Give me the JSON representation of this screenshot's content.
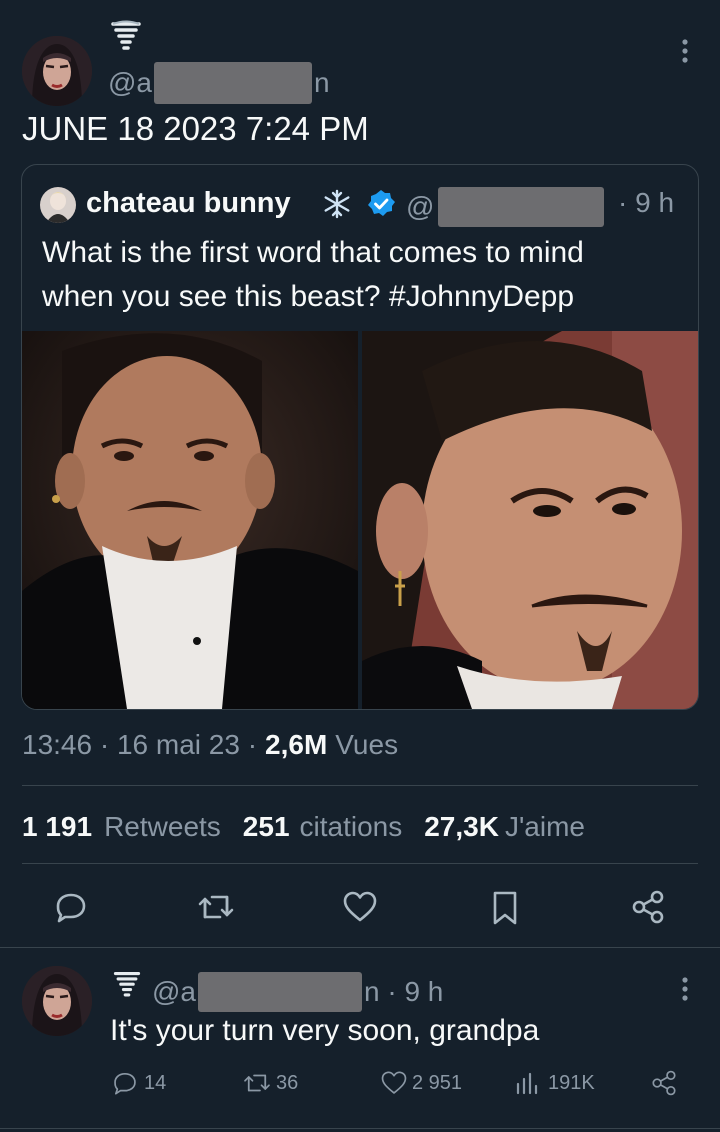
{
  "tweet": {
    "handle_prefix": "@a",
    "handle_suffix": "n",
    "timestamp": "JUNE 18 2023 7:24 PM"
  },
  "quote": {
    "name": "chateau bunny",
    "handle_prefix": "@",
    "time": "· 9 h",
    "text_line1": "What is the first word that comes to mind",
    "text_line2": "when you see this beast? #JohnnyDepp"
  },
  "meta": {
    "time": "13:46 · 16 mai 23 ·",
    "views_count": "2,6M",
    "views_label": "Vues"
  },
  "stats": {
    "retweets_count": "1 191",
    "retweets_label": "Retweets",
    "quotes_count": "251",
    "quotes_label": "citations",
    "likes_count": "27,3K",
    "likes_label": "J'aime"
  },
  "reply": {
    "handle_prefix": "@a",
    "handle_suffix": "n · 9 h",
    "text": "It's your turn very soon, grandpa",
    "replies": "14",
    "retweets": "36",
    "likes": "2 951",
    "views": "191K"
  },
  "colors": {
    "background": "#15202b",
    "text": "#f7f9f9",
    "secondary": "#8b98a5",
    "divider": "#38444d",
    "verified": "#1d9bf0"
  },
  "icons": [
    "tornado-icon",
    "snowflake-icon",
    "verified-icon",
    "more-icon",
    "reply-icon",
    "retweet-icon",
    "like-icon",
    "bookmark-icon",
    "share-icon",
    "views-icon"
  ]
}
